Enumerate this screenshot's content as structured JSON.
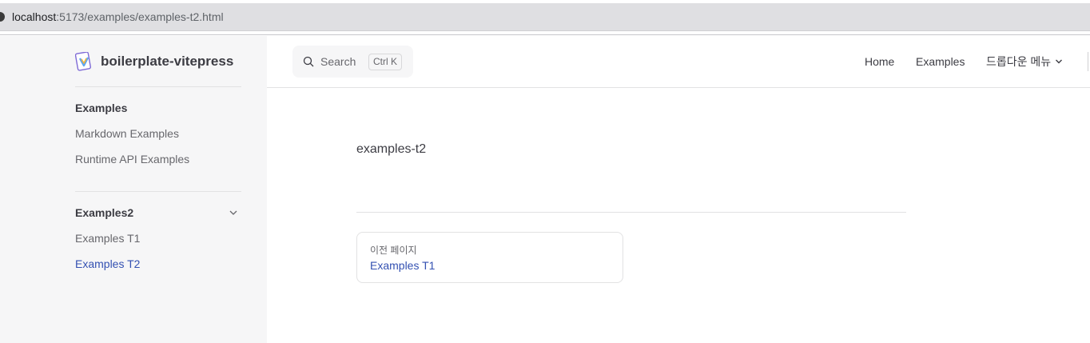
{
  "browser": {
    "url_host": "localhost",
    "url_rest": ":5173/examples/examples-t2.html"
  },
  "sidebar": {
    "brand": "boilerplate-vitepress",
    "groups": [
      {
        "heading": "Examples",
        "items": [
          "Markdown Examples",
          "Runtime API Examples"
        ]
      },
      {
        "heading": "Examples2",
        "items": [
          "Examples T1",
          "Examples T2"
        ],
        "active_item": "Examples T2"
      }
    ]
  },
  "nav": {
    "search_label": "Search",
    "search_shortcut": "Ctrl K",
    "links": [
      "Home",
      "Examples"
    ],
    "dropdown_label": "드롭다운 메뉴"
  },
  "content": {
    "body_text": "examples-t2",
    "prev_label": "이전 페이지",
    "prev_title": "Examples T1"
  },
  "colors": {
    "accent": "#3451b2",
    "sidebar_bg": "#f6f6f7",
    "text": "#3c3c43"
  }
}
